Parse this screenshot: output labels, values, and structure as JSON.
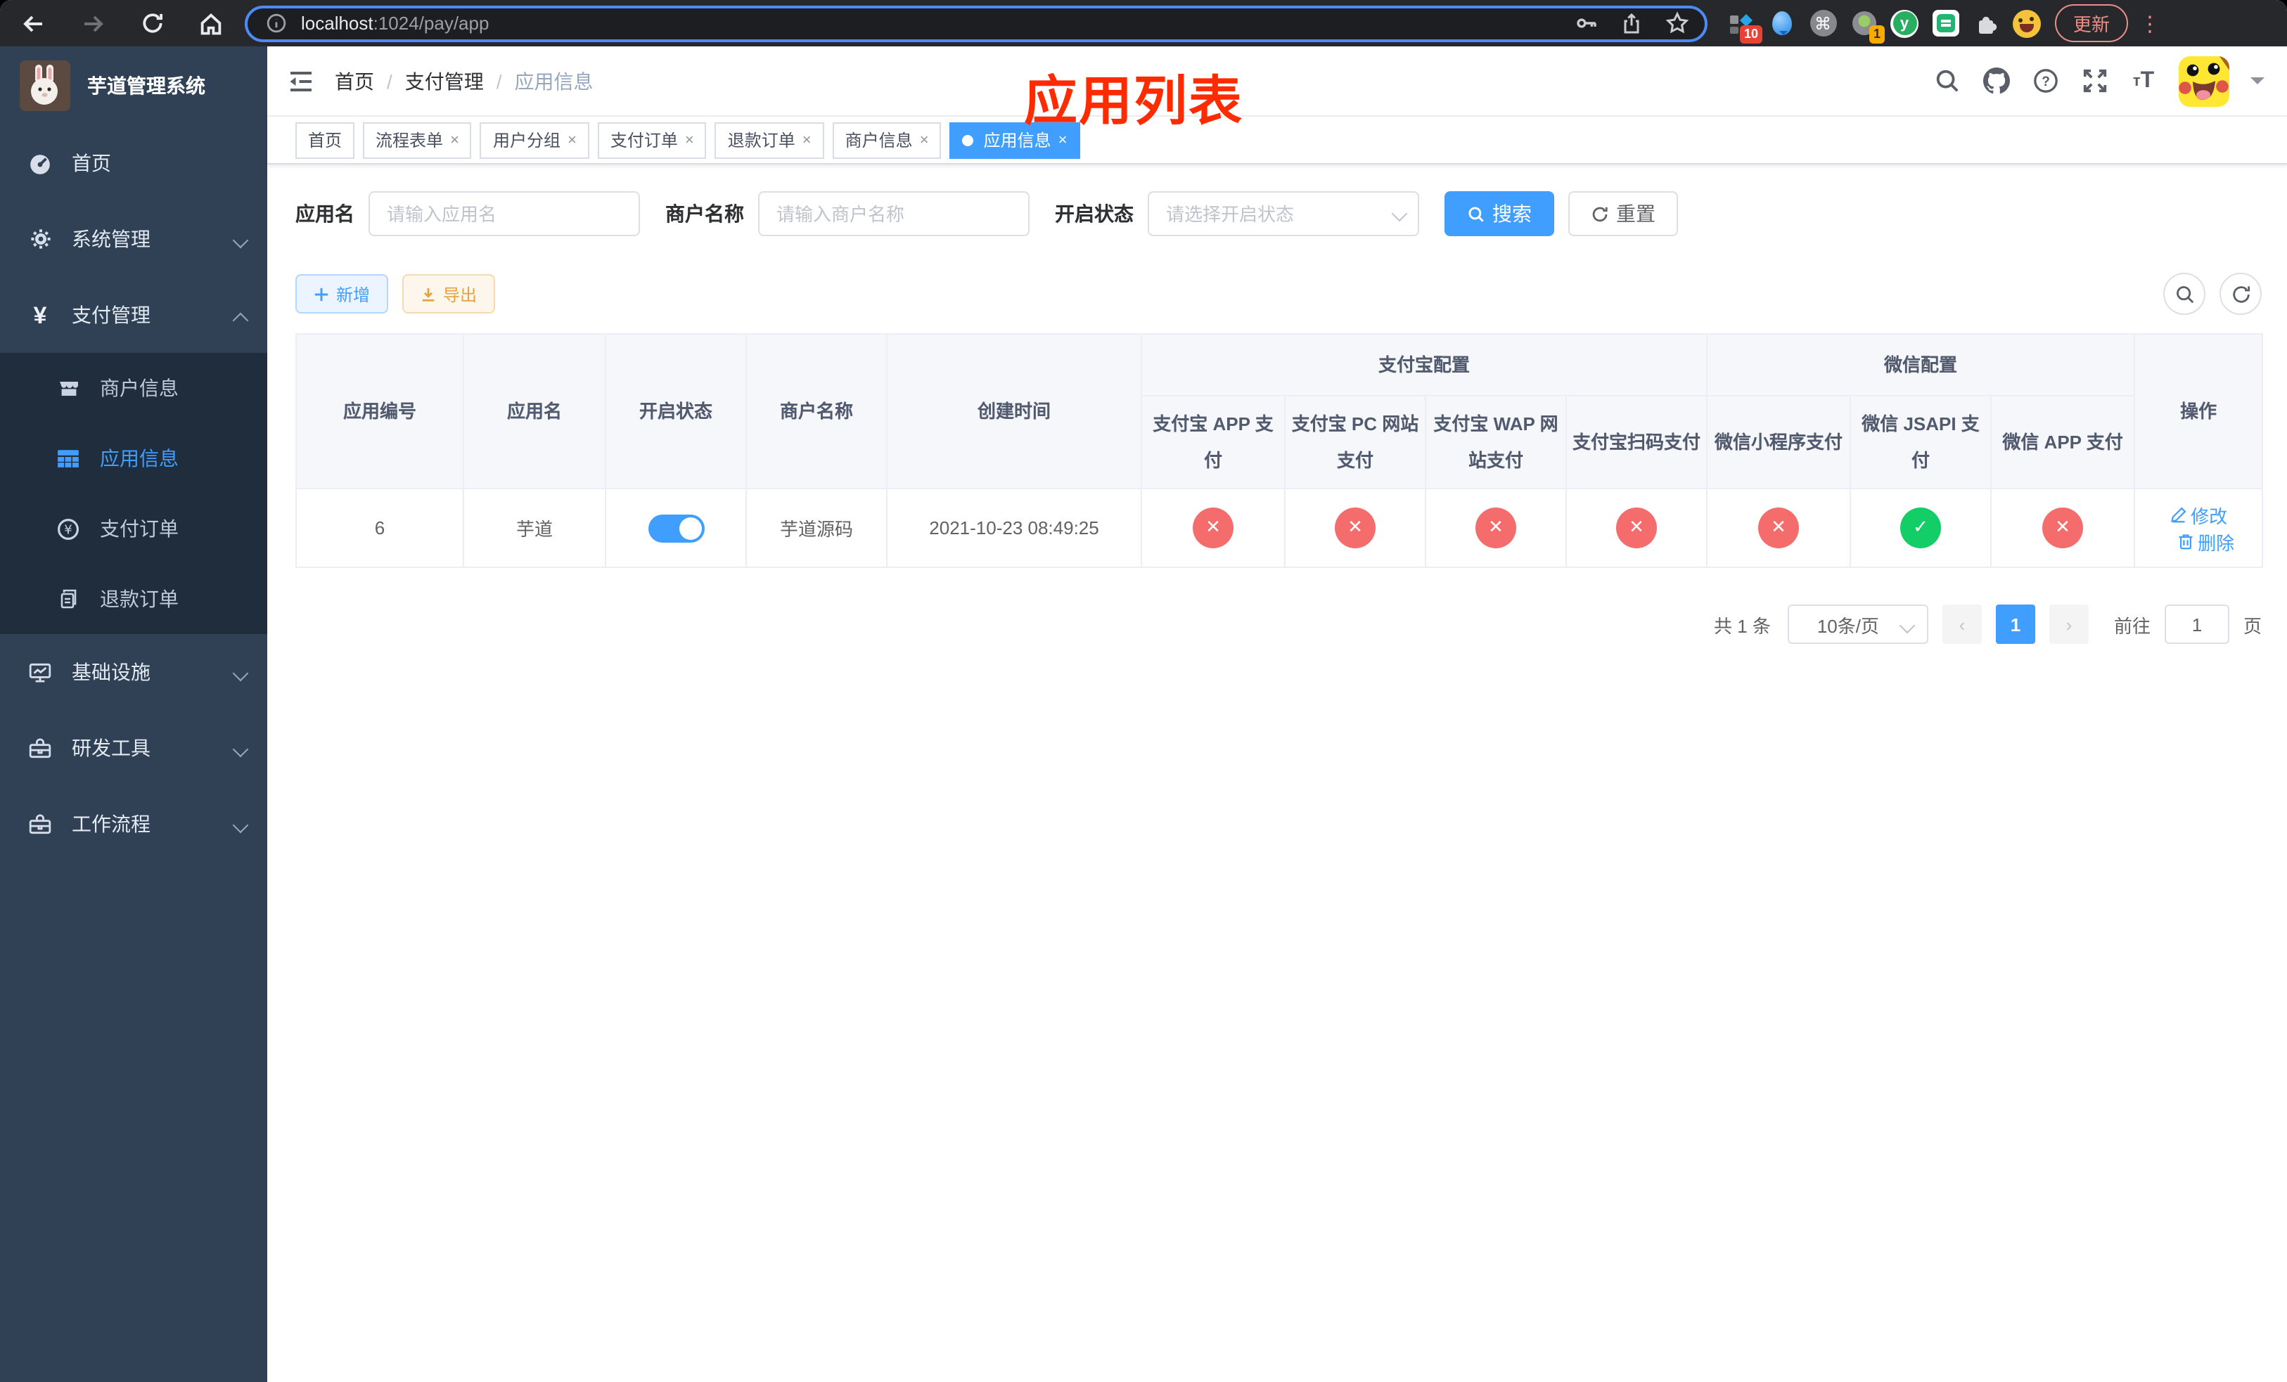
{
  "browser": {
    "url_host": "localhost",
    "url_rest": ":1024/pay/app",
    "ext_badge_blocks": "10",
    "ext_badge_record": "1",
    "update_button": "更新",
    "menu_dots": "⋮"
  },
  "sidebar": {
    "logo_title": "芋道管理系统",
    "menu": [
      {
        "label": "首页"
      },
      {
        "label": "系统管理"
      },
      {
        "label": "支付管理"
      },
      {
        "label": "基础设施"
      },
      {
        "label": "研发工具"
      },
      {
        "label": "工作流程"
      }
    ],
    "submenu": [
      {
        "label": "商户信息"
      },
      {
        "label": "应用信息"
      },
      {
        "label": "支付订单"
      },
      {
        "label": "退款订单"
      }
    ]
  },
  "header": {
    "breadcrumb": [
      "首页",
      "支付管理",
      "应用信息"
    ],
    "overlay_title": "应用列表"
  },
  "tabs": [
    {
      "label": "首页"
    },
    {
      "label": "流程表单"
    },
    {
      "label": "用户分组"
    },
    {
      "label": "支付订单"
    },
    {
      "label": "退款订单"
    },
    {
      "label": "商户信息"
    },
    {
      "label": "应用信息"
    }
  ],
  "filters": {
    "app_name_label": "应用名",
    "app_name_placeholder": "请输入应用名",
    "merchant_label": "商户名称",
    "merchant_placeholder": "请输入商户名称",
    "status_label": "开启状态",
    "status_placeholder": "请选择开启状态",
    "search_button": "搜索",
    "reset_button": "重置"
  },
  "toolbar": {
    "add_button": "新增",
    "export_button": "导出"
  },
  "table": {
    "group_headers": [
      "支付宝配置",
      "微信配置"
    ],
    "columns": [
      "应用编号",
      "应用名",
      "开启状态",
      "商户名称",
      "创建时间"
    ],
    "pay_columns": [
      "支付宝 APP 支付",
      "支付宝 PC 网站支付",
      "支付宝 WAP 网站支付",
      "支付宝扫码支付",
      "微信小程序支付",
      "微信 JSAPI 支付",
      "微信 APP 支付"
    ],
    "op_column": "操作",
    "rows": [
      {
        "id": "6",
        "name": "芋道",
        "enabled": true,
        "merchant": "芋道源码",
        "created_at": "2021-10-23 08:49:25",
        "pay_status": [
          false,
          false,
          false,
          false,
          false,
          true,
          false
        ],
        "edit_label": "修改",
        "delete_label": "删除"
      }
    ]
  },
  "pagination": {
    "total_text": "共 1 条",
    "page_size": "10条/页",
    "current_page": "1",
    "goto_label": "前往",
    "goto_value": "1",
    "page_label": "页"
  },
  "colors": {
    "primary": "#409eff",
    "tab_active": "#409eff",
    "danger": "#f56c6c",
    "success": "#13ce66",
    "warning": "#e6a23c",
    "sidebar_bg": "#304156",
    "submenu_bg": "#1f2d3d"
  }
}
